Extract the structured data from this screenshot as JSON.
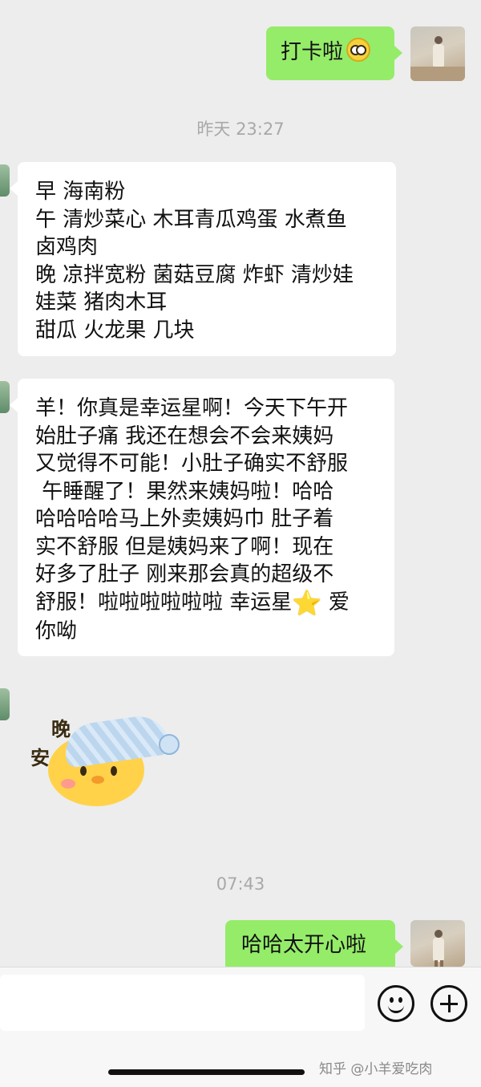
{
  "messages": {
    "m1": {
      "text": "打卡啦",
      "emoji": "dizzy-face-emoji"
    },
    "time1": "昨天 23:27",
    "m2": {
      "lines": [
        "早 海南粉",
        "午 清炒菜心 木耳青瓜鸡蛋 水煮鱼",
        "卤鸡肉",
        "晚 凉拌宽粉 菌菇豆腐 炸虾 清炒娃",
        "娃菜 猪肉木耳",
        "甜瓜 火龙果 几块"
      ]
    },
    "m3": {
      "lines": [
        "羊！你真是幸运星啊！今天下午开",
        "始肚子痛 我还在想会不会来姨妈",
        "又觉得不可能！小肚子确实不舒服",
        " 午睡醒了！果然来姨妈啦！哈哈",
        "哈哈哈哈马上外卖姨妈巾 肚子着",
        "实不舒服 但是姨妈来了啊！现在",
        "好多了肚子 刚来那会真的超级不"
      ],
      "line8_before": "舒服！啦啦啦啦啦啦 幸运星",
      "star": "⭐",
      "line8_after": " 爱",
      "line9": "你呦"
    },
    "sticker": {
      "text1": "晚",
      "text2": "安"
    },
    "time2": "07:43",
    "m4": {
      "text": "哈哈太开心啦"
    }
  },
  "watermark": "知乎 @小羊爱吃肉"
}
